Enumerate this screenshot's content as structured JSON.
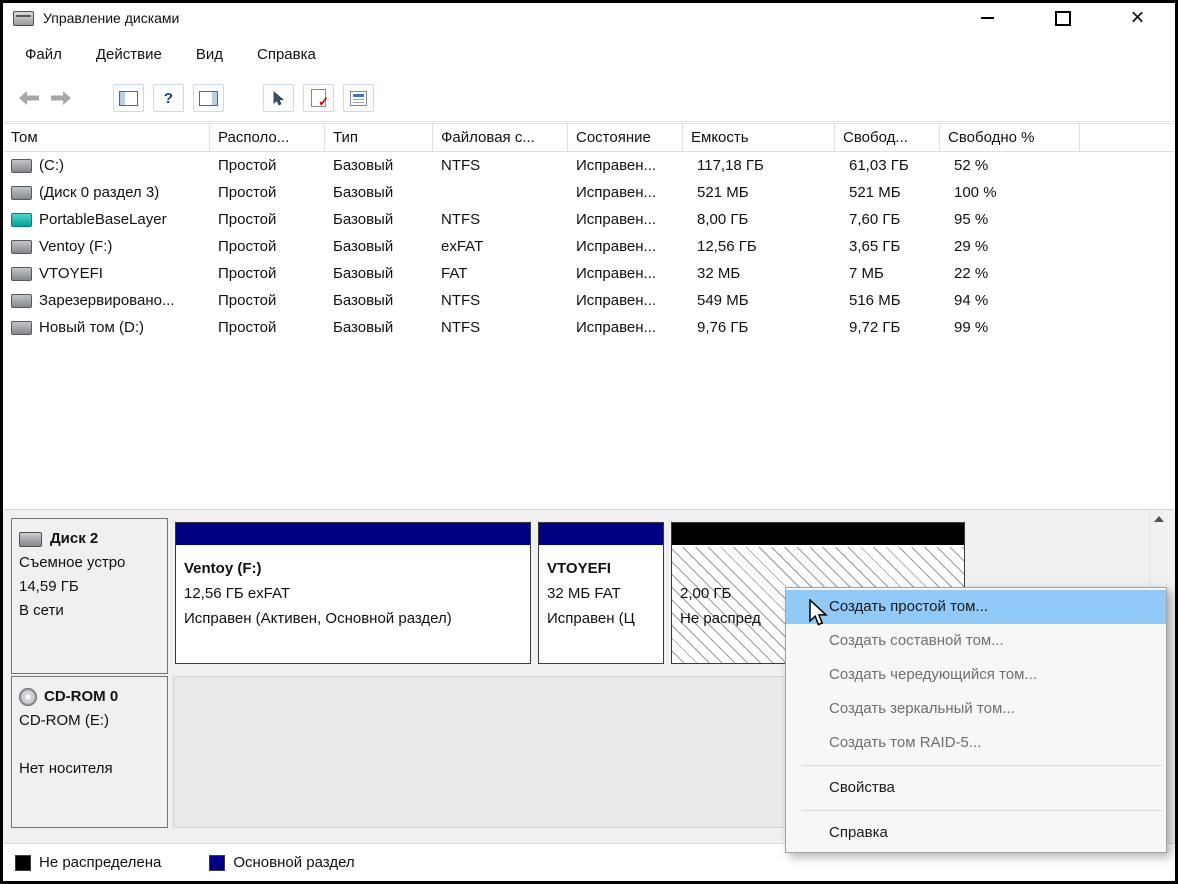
{
  "window": {
    "title": "Управление дисками"
  },
  "menubar": {
    "items": [
      "Файл",
      "Действие",
      "Вид",
      "Справка"
    ]
  },
  "toolbar": {
    "icons": [
      "back-arrow",
      "forward-arrow",
      "console-tree",
      "help",
      "action-pane",
      "pointer",
      "document-check",
      "list"
    ]
  },
  "volumes": {
    "columns": [
      "Том",
      "Располо...",
      "Тип",
      "Файловая с...",
      "Состояние",
      "Емкость",
      "Свобод...",
      "Свободно %"
    ],
    "rows": [
      {
        "name": "(C:)",
        "layout": "Простой",
        "type": "Базовый",
        "fs": "NTFS",
        "status": "Исправен...",
        "capacity": "117,18 ГБ",
        "free": "61,03 ГБ",
        "free_pct": "52 %"
      },
      {
        "name": "(Диск 0 раздел 3)",
        "layout": "Простой",
        "type": "Базовый",
        "fs": "",
        "status": "Исправен...",
        "capacity": "521 МБ",
        "free": "521 МБ",
        "free_pct": "100 %"
      },
      {
        "name": "PortableBaseLayer",
        "layout": "Простой",
        "type": "Базовый",
        "fs": "NTFS",
        "status": "Исправен...",
        "capacity": "8,00 ГБ",
        "free": "7,60 ГБ",
        "free_pct": "95 %"
      },
      {
        "name": "Ventoy (F:)",
        "layout": "Простой",
        "type": "Базовый",
        "fs": "exFAT",
        "status": "Исправен...",
        "capacity": "12,56 ГБ",
        "free": "3,65 ГБ",
        "free_pct": "29 %"
      },
      {
        "name": "VTOYEFI",
        "layout": "Простой",
        "type": "Базовый",
        "fs": "FAT",
        "status": "Исправен...",
        "capacity": "32 МБ",
        "free": "7 МБ",
        "free_pct": "22 %"
      },
      {
        "name": "Зарезервировано...",
        "layout": "Простой",
        "type": "Базовый",
        "fs": "NTFS",
        "status": "Исправен...",
        "capacity": "549 МБ",
        "free": "516 МБ",
        "free_pct": "94 %"
      },
      {
        "name": "Новый том (D:)",
        "layout": "Простой",
        "type": "Базовый",
        "fs": "NTFS",
        "status": "Исправен...",
        "capacity": "9,76 ГБ",
        "free": "9,72 ГБ",
        "free_pct": "99 %"
      }
    ]
  },
  "disk2": {
    "label": "Диск 2",
    "kind": "Съемное устро",
    "size": "14,59 ГБ",
    "state": "В сети",
    "partitions": {
      "ventoy": {
        "title": "Ventoy (F:)",
        "size_fs": "12,56 ГБ exFAT",
        "status": "Исправен (Активен, Основной раздел)"
      },
      "vtoyefi": {
        "title": "VTOYEFI",
        "size_fs": "32 МБ FAT",
        "status": "Исправен (Ц"
      },
      "unallocated": {
        "size": "2,00 ГБ",
        "state": "Не распред"
      }
    }
  },
  "cdrom": {
    "label": "CD-ROM 0",
    "drive": "CD-ROM (E:)",
    "state": "Нет носителя"
  },
  "context_menu": {
    "items": [
      {
        "label": "Создать простой том..."
      },
      {
        "label": "Создать составной том..."
      },
      {
        "label": "Создать чередующийся том..."
      },
      {
        "label": "Создать зеркальный том..."
      },
      {
        "label": "Создать том RAID-5..."
      },
      {
        "label": "Свойства"
      },
      {
        "label": "Справка"
      }
    ]
  },
  "legend": {
    "unallocated": {
      "label": "Не распределена",
      "color": "#000000"
    },
    "primary": {
      "label": "Основной раздел",
      "color": "#000082"
    }
  },
  "colors": {
    "partition_band": "#000082",
    "unallocated_band": "#000000",
    "menu_highlight": "#91c9f7"
  }
}
